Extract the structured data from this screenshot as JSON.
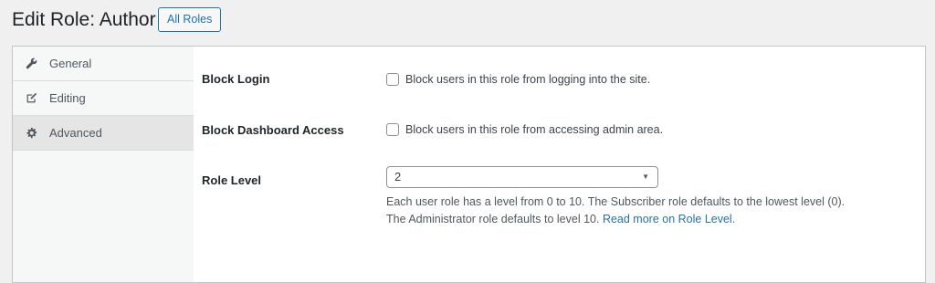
{
  "header": {
    "title": "Edit Role: Author",
    "all_roles_label": "All Roles"
  },
  "sidebar": {
    "tabs": [
      {
        "label": "General",
        "icon": "wrench-icon"
      },
      {
        "label": "Editing",
        "icon": "edit-icon"
      },
      {
        "label": "Advanced",
        "icon": "gear-icon",
        "active": true
      }
    ]
  },
  "settings": {
    "block_login": {
      "label": "Block Login",
      "checkbox_text": "Block users in this role from logging into the site.",
      "checked": false
    },
    "block_dashboard": {
      "label": "Block Dashboard Access",
      "checkbox_text": "Block users in this role from accessing admin area.",
      "checked": false
    },
    "role_level": {
      "label": "Role Level",
      "selected_value": "2",
      "description_line1": "Each user role has a level from 0 to 10. The Subscriber role defaults to the lowest level (0).",
      "description_line2": "The Administrator role defaults to level 10.",
      "link_text": "Read more on Role Level."
    }
  },
  "colors": {
    "accent": "#2271b1",
    "sidebar_bg": "#f6f7f7",
    "active_tab_bg": "#e5e5e5",
    "page_bg": "#f0f0f1"
  }
}
